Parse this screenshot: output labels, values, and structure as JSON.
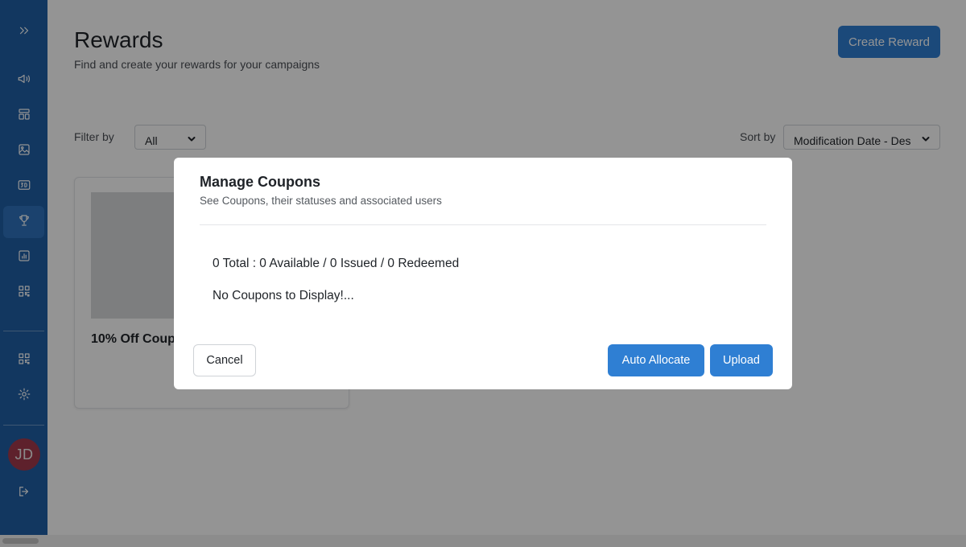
{
  "sidebar": {
    "items": [
      {
        "icon": "expand-icon"
      },
      {
        "icon": "megaphone-icon"
      },
      {
        "icon": "layout-icon"
      },
      {
        "icon": "image-icon"
      },
      {
        "icon": "3d-icon",
        "label": "3D"
      },
      {
        "icon": "trophy-icon",
        "active": true
      },
      {
        "icon": "bar-chart-icon"
      },
      {
        "icon": "qr-code-icon"
      },
      {
        "icon": "qr-code-icon"
      },
      {
        "icon": "gear-icon"
      },
      {
        "icon": "logout-icon"
      }
    ],
    "user_initials": "JD",
    "active_color": "#2f73bd",
    "background_color": "#1f5fa6"
  },
  "header": {
    "title": "Rewards",
    "subtitle": "Find and create your rewards for your campaigns",
    "create_button": "Create Reward"
  },
  "filters": {
    "filter_label": "Filter by",
    "filter_value": "All",
    "sort_label": "Sort by",
    "sort_value": "Modification Date - Des"
  },
  "rewards": [
    {
      "title": "10% Off Coupon"
    }
  ],
  "modal": {
    "title": "Manage Coupons",
    "subtitle": "See Coupons, their statuses and associated users",
    "stats": "0 Total : 0 Available / 0 Issued / 0 Redeemed",
    "empty_message": "No Coupons to Display!...",
    "cancel_label": "Cancel",
    "auto_allocate_label": "Auto Allocate",
    "upload_label": "Upload"
  },
  "colors": {
    "primary": "#2f7fd3",
    "sidebar": "#1f5fa6",
    "avatar": "#a33a4c"
  }
}
